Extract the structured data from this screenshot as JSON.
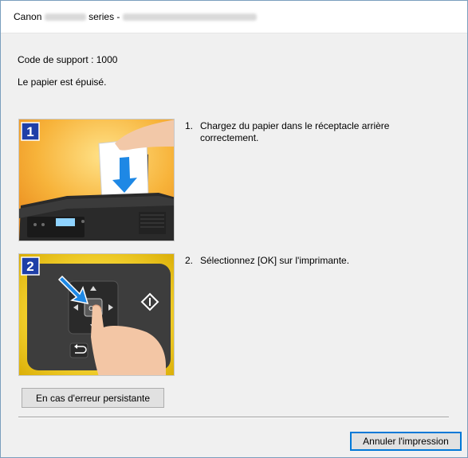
{
  "window": {
    "title_prefix": "Canon",
    "title_middle": "series -"
  },
  "support_code": "Code de support : 1000",
  "message": "Le papier est épuisé.",
  "steps": [
    {
      "badge": "1",
      "number": "1.",
      "text": "Chargez du papier dans le réceptacle arrière correctement.",
      "illustration": "printer-paper-loading"
    },
    {
      "badge": "2",
      "number": "2.",
      "text": "Sélectionnez [OK] sur l'imprimante.",
      "illustration": "printer-ok-button-press",
      "ok_label": "OK"
    }
  ],
  "buttons": {
    "persistent_error": "En cas d'erreur persistante",
    "cancel_print": "Annuler l'impression"
  },
  "colors": {
    "accent": "#0078d7",
    "badge_blue": "#1f3fa8",
    "arrow_blue": "#1e88e5",
    "step1_bg": "#f5a623",
    "step2_bg": "#e8c200"
  }
}
